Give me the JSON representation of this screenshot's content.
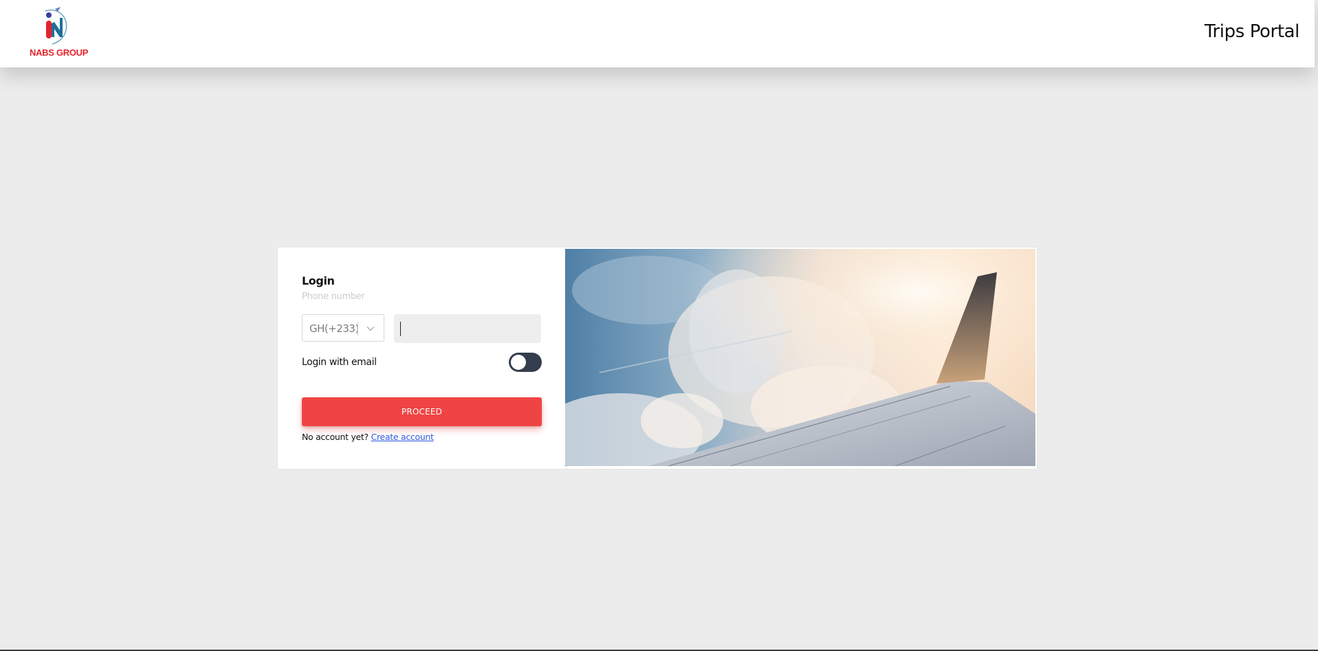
{
  "header": {
    "logo_text": "NABS GROUP",
    "portal_title": "Trips Portal"
  },
  "login": {
    "title": "Login",
    "phone_label": "Phone number",
    "country_code": "GH(+233)",
    "phone_value": "",
    "email_toggle_label": "Login with email",
    "email_toggle_on": false,
    "proceed_label": "PROCEED",
    "no_account_text": "No account yet?",
    "create_account_label": "Create account"
  },
  "colors": {
    "brand_red": "#ef4444",
    "logo_red": "#e4232b",
    "toggle_dark": "#343d4d",
    "link_blue": "#2b59e0",
    "page_background": "#ececec"
  }
}
